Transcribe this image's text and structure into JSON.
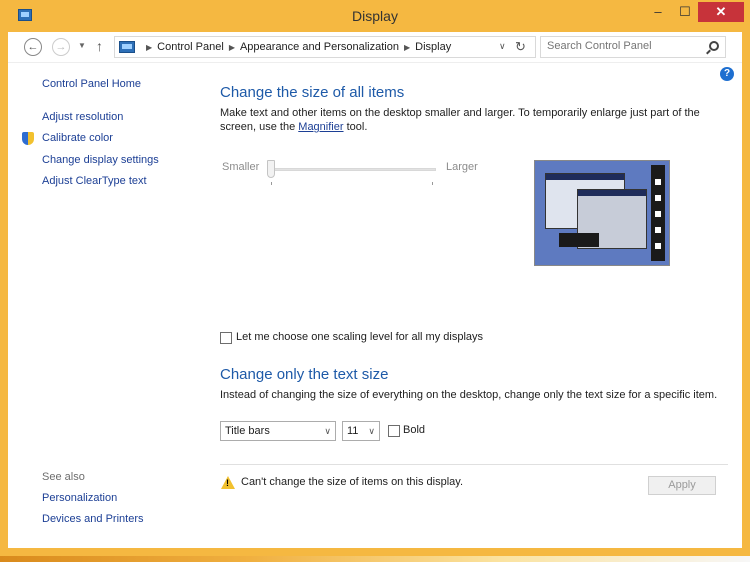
{
  "window": {
    "title": "Display",
    "minimize_label": "–",
    "maximize_label": "☐",
    "close_label": "✕"
  },
  "nav": {
    "back_glyph": "←",
    "forward_glyph": "→",
    "recent_glyph": "▼",
    "up_glyph": "↑",
    "breadcrumbs": [
      "Control Panel",
      "Appearance and Personalization",
      "Display"
    ],
    "dropdown_glyph": "∨",
    "refresh_glyph": "↻",
    "search_placeholder": "Search Control Panel"
  },
  "sidebar": {
    "home": "Control Panel Home",
    "links": [
      "Adjust resolution",
      "Calibrate color",
      "Change display settings",
      "Adjust ClearType text"
    ],
    "see_also_heading": "See also",
    "see_also": [
      "Personalization",
      "Devices and Printers"
    ]
  },
  "main": {
    "help_glyph": "?",
    "section1_title": "Change the size of all items",
    "section1_desc_before": "Make text and other items on the desktop smaller and larger. To temporarily enlarge just part of the screen, use the ",
    "section1_desc_link": "Magnifier",
    "section1_desc_after": " tool.",
    "slider_smaller": "Smaller",
    "slider_larger": "Larger",
    "slider_value_fraction": 0.0,
    "scaling_checkbox_label": "Let me choose one scaling level for all my displays",
    "scaling_checked": false,
    "section2_title": "Change only the text size",
    "section2_desc": "Instead of changing the size of everything on the desktop, change only the text size for a specific item.",
    "item_select": "Title bars",
    "size_select": "11",
    "bold_label": "Bold",
    "bold_checked": false,
    "warning_glyph": "!",
    "warning_text": "Can't change the size of items on this display.",
    "apply_label": "Apply"
  },
  "colors": {
    "title_bar": "#f5b841",
    "link": "#1c3f95",
    "heading": "#1e5aa8",
    "close_button": "#c7333a"
  }
}
